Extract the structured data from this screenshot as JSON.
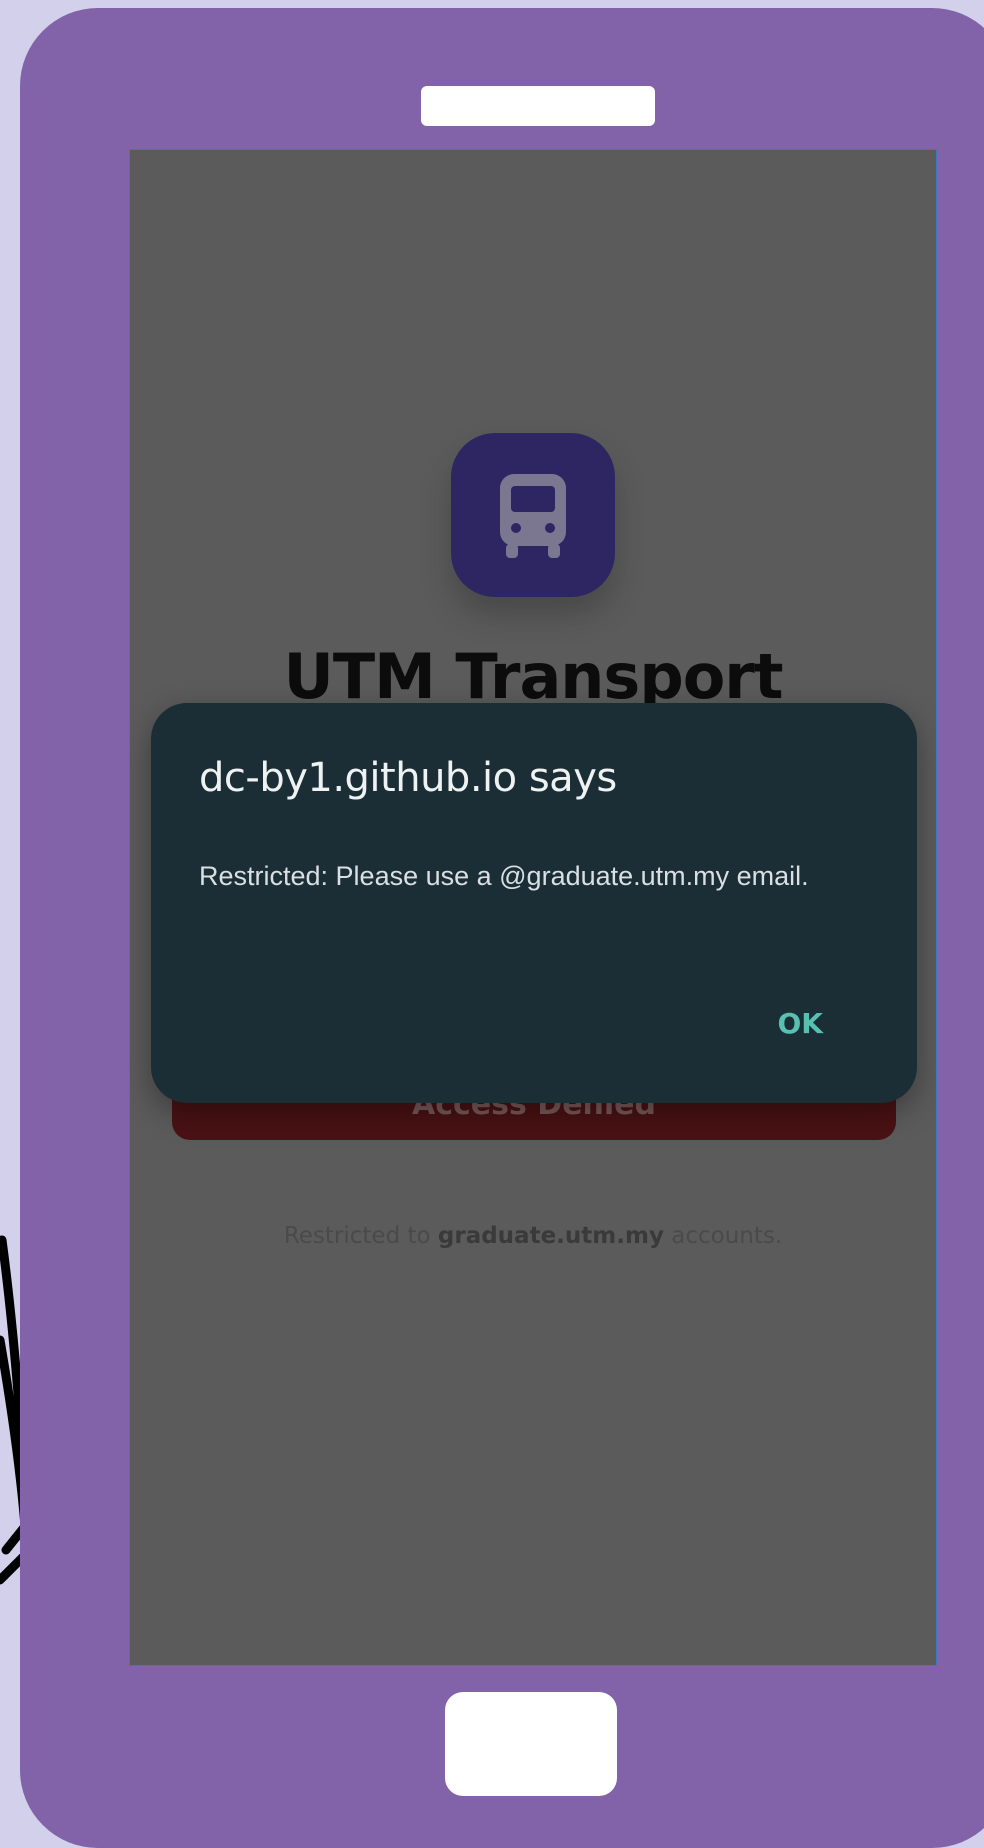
{
  "app": {
    "title": "UTM Transport",
    "icon": "bus-icon",
    "icon_color": "#2d2663"
  },
  "login": {
    "button_label": "Access Denied",
    "note_prefix": "Restricted to ",
    "note_domain": "graduate.utm.my",
    "note_suffix": " accounts."
  },
  "dialog": {
    "title": "dc-by1.github.io says",
    "message": "Restricted: Please use a @graduate.utm.my email.",
    "ok_label": "OK",
    "background": "#1b2d35",
    "accent": "#57c0b0"
  },
  "device": {
    "frame_color": "#8263a9",
    "page_background": "#d3d0ec"
  }
}
